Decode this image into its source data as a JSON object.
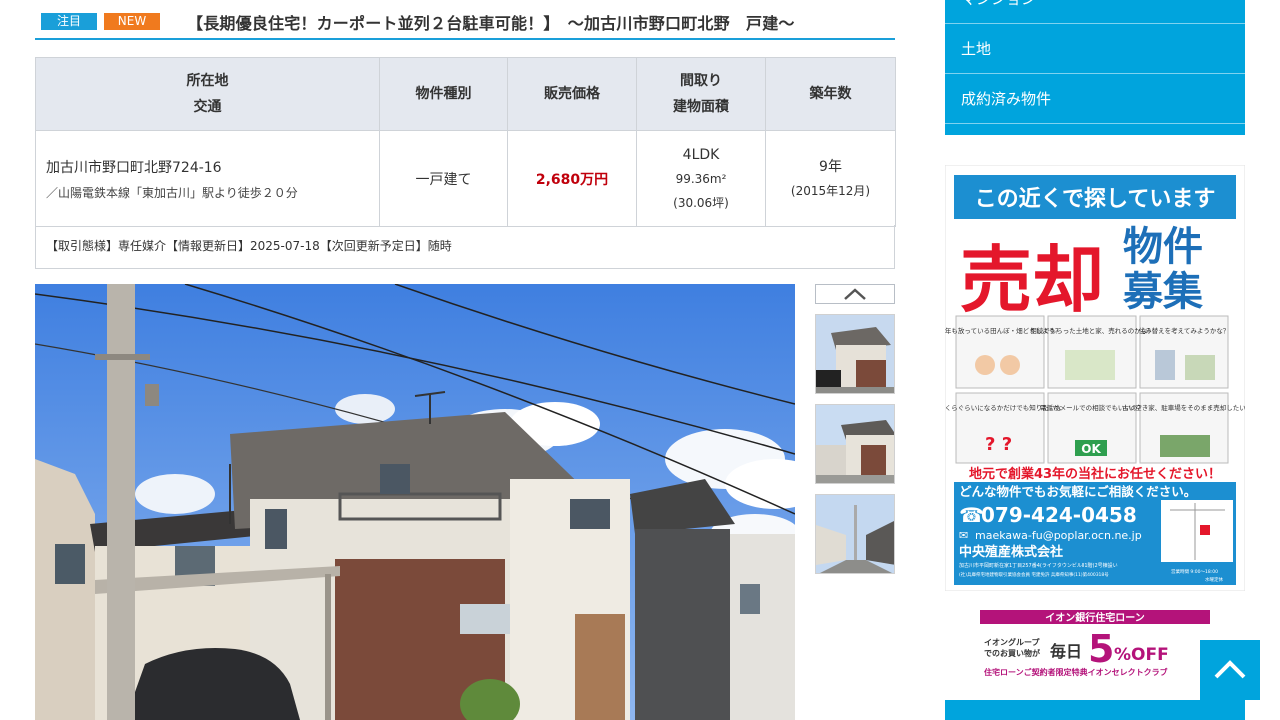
{
  "colors": {
    "accent": "#1a9fd9",
    "new_tag": "#f07a1e",
    "price": "#c0000c",
    "sidebar": "#00a4dd",
    "table_header": "#e4e8ef"
  },
  "title": {
    "tag_attention": "注目",
    "tag_new": "NEW",
    "text": "【長期優良住宅！カーポート並列２台駐車可能！】　～加古川市野口町北野　戸建～"
  },
  "table": {
    "headers": {
      "location": "所在地",
      "access": "交通",
      "type": "物件種別",
      "price": "販売価格",
      "layout": "間取り",
      "area": "建物面積",
      "age": "築年数"
    },
    "row": {
      "address": "加古川市野口町北野724-16",
      "station": "／山陽電鉄本線「東加古川」駅より徒歩２０分",
      "type": "一戸建て",
      "price": "2,680万円",
      "layout": "4LDK",
      "area_m2": "99.36m²",
      "area_tsubo": "(30.06坪)",
      "age": "9年",
      "built": "(2015年12月)"
    },
    "footnote": "【取引態様】専任媒介【情報更新日】2025-07-18【次回更新予定日】随時"
  },
  "sidebar": {
    "menu": [
      "マンション",
      "土地",
      "成約済み物件"
    ]
  },
  "ad": {
    "headline": "この近くで探しています",
    "big1": "売却",
    "big2a": "物件",
    "big2b": "募集",
    "cards": [
      "何年も放っている田んぼ・畑どうしよう？",
      "相続でもらった土地と家、売れるのかな？",
      "住み替えを考えてみようかな？",
      "いくらぐらいになるかだけでも知りたいな",
      "電話かメールでの相談でもいいの？",
      "古い空き家、駐車場をそのまま売却したい"
    ],
    "ok": "OK",
    "slogan": "地元で創業43年の当社にお任せください！",
    "slogan2": "どんな物件でもお気軽にご相談ください。",
    "phone": "079-424-0458",
    "email": "maekawa-fu@poplar.ocn.ne.jp",
    "company": "中央殖産株式会社",
    "address": "加古川市平岡町新在家1丁目257番4(ライフタウンビルⅡ1階)2号棟設い",
    "license": "(社)兵庫県宅地建物取引業協会会員 宅建免許 兵庫県知事(11)第400318号",
    "hours": "営業時間 9:00～18:00",
    "holiday": "水曜定休"
  },
  "ad2": {
    "top": "イオン銀行住宅ローン",
    "left1": "イオングループ",
    "left2": "でのお買い物が",
    "mid": "毎日",
    "big": "5",
    "pct": "%OFF",
    "bottom": "住宅ローンご契約者限定特典イオンセレクトクラブ"
  }
}
